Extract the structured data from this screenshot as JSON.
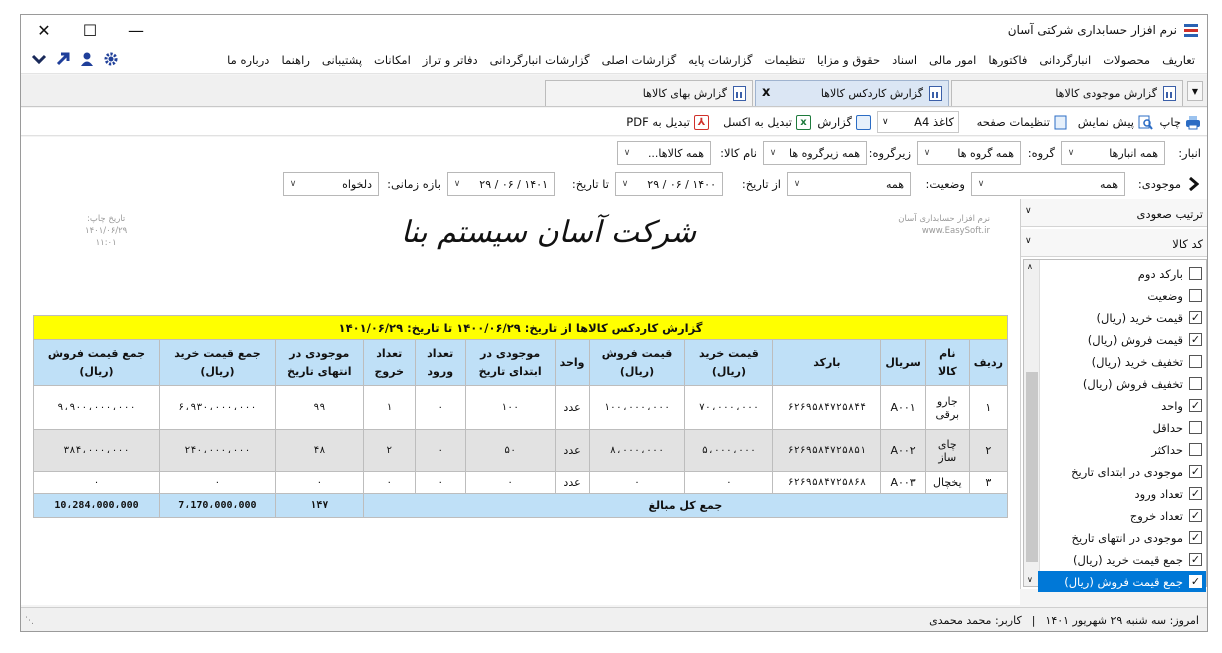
{
  "window": {
    "title": "نرم افزار حسابداری شرکتی آسان"
  },
  "menu": [
    "تعاریف",
    "محصولات",
    "انبارگردانی",
    "فاکتورها",
    "امور مالی",
    "اسناد",
    "حقوق و مزایا",
    "تنظیمات",
    "گزارشات پایه",
    "گزارشات اصلی",
    "گزارشات انبارگردانی",
    "دفاتر و تراز",
    "امکانات",
    "پشتیبانی",
    "راهنما",
    "درباره ما"
  ],
  "tabs": {
    "t1": "گزارش موجودی کالاها",
    "t2": "گزارش کاردکس کالاها",
    "t3": "گزارش بهای کالاها",
    "close": "x"
  },
  "toolbar": {
    "print": "چاپ",
    "preview": "پیش نمایش",
    "page_setup": "تنظیمات صفحه",
    "paper": "کاغذ A4",
    "report": "گزارش",
    "excel": "تبدیل به اکسل",
    "pdf": "تبدیل به PDF"
  },
  "filters": {
    "warehouse_label": "انبار:",
    "warehouse_value": "همه انبارها",
    "group_label": "گروه:",
    "group_value": "همه گروه ها",
    "subgroup_label": "زیرگروه:",
    "subgroup_value": "همه زیرگروه ها",
    "item_label": "نام کالا:",
    "item_value": "همه کالاها...",
    "stock_label": "موجودی:",
    "stock_value": "همه",
    "status_label": "وضعیت:",
    "status_value": "همه",
    "from_label": "از تاریخ:",
    "from_value": "۱۴۰۰ / ۰۶ / ۲۹",
    "to_label": "تا تاریخ:",
    "to_value": "۱۴۰۱ / ۰۶ / ۲۹",
    "period_label": "بازه زمانی:",
    "period_value": "دلخواه"
  },
  "report": {
    "software": "نرم افزار حسابداری آسان",
    "site": "www.EasySoft.ir",
    "print_date_label": "تاریخ چاپ:",
    "print_date": "۱۴۰۱/۰۶/۲۹",
    "print_time": "۱۱:۰۱",
    "company": "شرکت آسان سیستم بنا",
    "caption": "گزارش کاردکس کالاها از تاریخ: ۱۴۰۰/۰۶/۲۹ تا تاریخ: ۱۴۰۱/۰۶/۲۹",
    "headers": [
      "ردیف",
      "نام کالا",
      "سریال",
      "بارکد",
      "قیمت خرید (ریال)",
      "قیمت فروش (ریال)",
      "واحد",
      "موجودی در ابتدای تاریخ",
      "تعداد ورود",
      "تعداد خروج",
      "موجودی در انتهای تاریخ",
      "جمع قیمت خرید (ریال)",
      "جمع قیمت فروش (ریال)"
    ],
    "rows": [
      [
        "۱",
        "جارو برقی",
        "A۰۰۱",
        "۶۲۶۹۵۸۴۷۲۵۸۴۴",
        "۷۰،۰۰۰،۰۰۰",
        "۱۰۰،۰۰۰،۰۰۰",
        "عدد",
        "۱۰۰",
        "۰",
        "۱",
        "۹۹",
        "۶،۹۳۰،۰۰۰،۰۰۰",
        "۹،۹۰۰،۰۰۰،۰۰۰"
      ],
      [
        "۲",
        "چای ساز",
        "A۰۰۲",
        "۶۲۶۹۵۸۴۷۲۵۸۵۱",
        "۵،۰۰۰،۰۰۰",
        "۸،۰۰۰،۰۰۰",
        "عدد",
        "۵۰",
        "۰",
        "۲",
        "۴۸",
        "۲۴۰،۰۰۰،۰۰۰",
        "۳۸۴،۰۰۰،۰۰۰"
      ],
      [
        "۳",
        "یخچال",
        "A۰۰۳",
        "۶۲۶۹۵۸۴۷۲۵۸۶۸",
        "۰",
        "۰",
        "عدد",
        "۰",
        "۰",
        "۰",
        "۰",
        "۰",
        "۰"
      ]
    ],
    "total_label": "جمع کل مبالغ",
    "total_qty": "۱۴۷",
    "total_buy": "7،170،000،000",
    "total_sell": "10،284،000،000"
  },
  "side": {
    "sort_label": "ترتیب صعودی",
    "sort_by": "کد کالا",
    "columns": [
      {
        "label": "بارکد دوم",
        "checked": false
      },
      {
        "label": "وضعیت",
        "checked": false
      },
      {
        "label": "قیمت خرید (ریال)",
        "checked": true
      },
      {
        "label": "قیمت فروش (ریال)",
        "checked": true
      },
      {
        "label": "تخفیف خرید (ریال)",
        "checked": false
      },
      {
        "label": "تخفیف فروش (ریال)",
        "checked": false
      },
      {
        "label": "واحد",
        "checked": true
      },
      {
        "label": "حداقل",
        "checked": false
      },
      {
        "label": "حداکثر",
        "checked": false
      },
      {
        "label": "موجودی در ابتدای تاریخ",
        "checked": true
      },
      {
        "label": "تعداد ورود",
        "checked": true
      },
      {
        "label": "تعداد خروج",
        "checked": true
      },
      {
        "label": "موجودی در انتهای تاریخ",
        "checked": true
      },
      {
        "label": "جمع قیمت خرید (ریال)",
        "checked": true
      },
      {
        "label": "جمع قیمت فروش (ریال)",
        "checked": true
      }
    ]
  },
  "status": {
    "today": "امروز: سه شنبه ۲۹ شهریور ۱۴۰۱",
    "user": "کاربر: محمد محمدی"
  }
}
